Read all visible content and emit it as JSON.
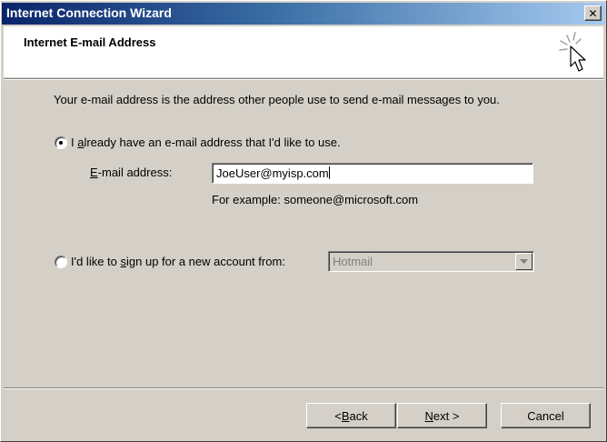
{
  "window": {
    "title": "Internet Connection Wizard",
    "close_glyph": "✕"
  },
  "header": {
    "title": "Internet E-mail Address",
    "icon": "wizard-cursor-icon"
  },
  "body": {
    "intro": "Your e-mail address is the address other people use to send e-mail messages to you."
  },
  "option_existing": {
    "label_pre": "I ",
    "label_accel": "a",
    "label_post": "lready have an e-mail address that I'd like to use.",
    "selected": true
  },
  "email": {
    "label_accel": "E",
    "label_post": "-mail address:",
    "value": "JoeUser@myisp.com",
    "example": "For example: someone@microsoft.com"
  },
  "option_new": {
    "label_pre": "I'd like to ",
    "label_accel": "s",
    "label_post": "ign up for a new account from:",
    "selected": false
  },
  "provider": {
    "selected": "Hotmail",
    "enabled": false
  },
  "buttons": {
    "back_pre": "< ",
    "back_accel": "B",
    "back_post": "ack",
    "next_accel": "N",
    "next_post": "ext >",
    "cancel": "Cancel"
  }
}
